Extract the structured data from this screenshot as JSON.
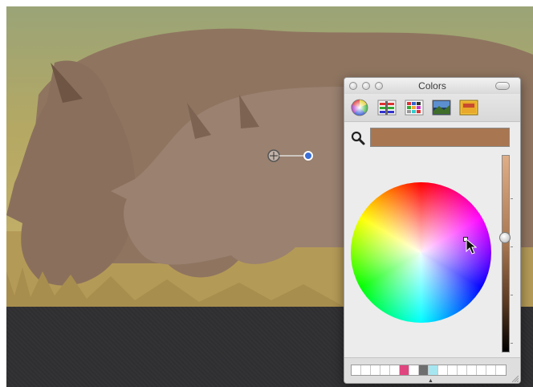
{
  "window": {
    "title": "Colors",
    "toolbar_tools": [
      "color-wheel-icon",
      "color-sliders-icon",
      "color-palettes-icon",
      "image-palettes-icon",
      "crayons-icon"
    ]
  },
  "current_color": "#a87650",
  "brightness_level": 0.58,
  "palette_cells": [
    "#ffffff",
    "#ffffff",
    "#ffffff",
    "#ffffff",
    "#ffffff",
    "#e0447f",
    "#ffffff",
    "#6e6e6e",
    "#a6e6f0",
    "#ffffff",
    "#ffffff",
    "#ffffff",
    "#ffffff",
    "#ffffff",
    "#ffffff",
    "#ffffff"
  ],
  "photo_subject": "rhinos",
  "colors": {
    "panel_bg": "#ececec",
    "dark_band": "#323234"
  }
}
